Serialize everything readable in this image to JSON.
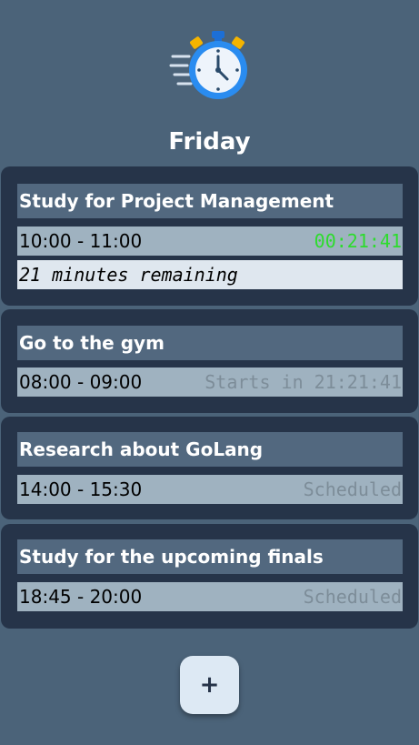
{
  "header": {
    "logo_icon": "stopwatch-icon",
    "day": "Friday"
  },
  "colors": {
    "background": "#4b6379",
    "card": "#263449",
    "active_countdown": "#2ddc2d",
    "muted_status": "#7d8d99"
  },
  "tasks": [
    {
      "title": "Study for Project Management",
      "time": "10:00 - 11:00",
      "status": "00:21:41",
      "status_kind": "active",
      "remaining": "21 minutes remaining"
    },
    {
      "title": "Go to the gym",
      "time": "08:00 - 09:00",
      "status": "Starts in 21:21:41",
      "status_kind": "upcoming"
    },
    {
      "title": "Research about GoLang",
      "time": "14:00 - 15:30",
      "status": "Scheduled",
      "status_kind": "scheduled"
    },
    {
      "title": "Study for the upcoming finals",
      "time": "18:45 - 20:00",
      "status": "Scheduled",
      "status_kind": "scheduled"
    }
  ],
  "add_button": {
    "label": "+",
    "icon": "plus-icon"
  }
}
